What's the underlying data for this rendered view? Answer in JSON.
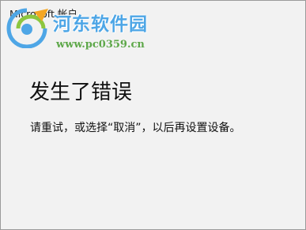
{
  "window": {
    "title": "Microsoft 帐户"
  },
  "watermark": {
    "site_name": "河东软件园",
    "site_url": "www.pc0359.cn",
    "colors": {
      "name": "#4ea6e6",
      "url": "#5ea84a"
    }
  },
  "error": {
    "heading": "发生了错误",
    "message": "请重试，或选择“取消”，以后再设置设备。"
  }
}
